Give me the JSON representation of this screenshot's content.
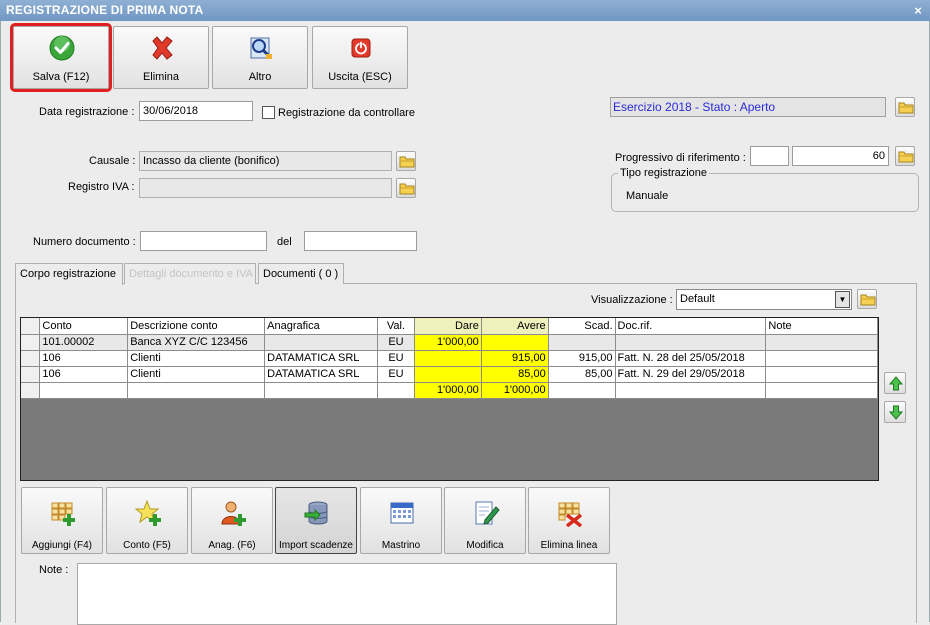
{
  "window": {
    "title": "REGISTRAZIONE DI PRIMA NOTA",
    "close": "×"
  },
  "toolbar": {
    "save": "Salva (F12)",
    "delete": "Elimina",
    "other": "Altro",
    "exit": "Uscita (ESC)"
  },
  "form": {
    "date_label": "Data registrazione :",
    "date_value": "30/06/2018",
    "check_label": "Registrazione da controllare",
    "causale_label": "Causale :",
    "causale_value": "Incasso da cliente (bonifico)",
    "registro_label": "Registro IVA :",
    "registro_value": "",
    "numero_label": "Numero documento :",
    "numero_value": "",
    "del_label": "del",
    "del_value": ""
  },
  "status": {
    "text": "Esercizio 2018 - Stato : Aperto",
    "color": "#2a2ad8"
  },
  "progressivo": {
    "label": "Progressivo di riferimento :",
    "prefix": "",
    "value": "60"
  },
  "tipo": {
    "title": "Tipo registrazione",
    "value": "Manuale"
  },
  "tabs": [
    {
      "label": "Corpo registrazione",
      "state": "active"
    },
    {
      "label": "Dettagli documento e IVA",
      "state": "disabled"
    },
    {
      "label": "Documenti ( 0 )",
      "state": "normal"
    }
  ],
  "view": {
    "label": "Visualizzazione :",
    "value": "Default"
  },
  "grid": {
    "columns": [
      "Conto",
      "Descrizione conto",
      "Anagrafica",
      "Val.",
      "Dare",
      "Avere",
      "Scad.",
      "Doc.rif.",
      "Note"
    ],
    "rows": [
      [
        "101.00002",
        "Banca XYZ C/C 123456",
        "",
        "EU",
        "1'000,00",
        "",
        "",
        "",
        ""
      ],
      [
        "106",
        "Clienti",
        "DATAMATICA SRL",
        "EU",
        "",
        "915,00",
        "915,00",
        "Fatt. N. 28 del 25/05/2018",
        ""
      ],
      [
        "106",
        "Clienti",
        "DATAMATICA SRL",
        "EU",
        "",
        "85,00",
        "85,00",
        "Fatt. N. 29 del 29/05/2018",
        ""
      ]
    ],
    "totals": {
      "dare": "1'000,00",
      "avere": "1'000,00"
    },
    "highlight_color": "#ffff00"
  },
  "actions": {
    "add": "Aggiungi (F4)",
    "conto": "Conto (F5)",
    "anag": "Anag. (F6)",
    "import": "Import scadenze",
    "mastrino": "Mastrino",
    "modifica": "Modifica",
    "elimina": "Elimina linea"
  },
  "notes": {
    "label": "Note :",
    "value": ""
  },
  "icons": {
    "save": "check-icon",
    "delete": "red-x-icon",
    "other": "search-document-icon",
    "exit": "power-icon",
    "folder": "folder-icon",
    "up": "arrow-up-icon",
    "down": "arrow-down-icon"
  }
}
